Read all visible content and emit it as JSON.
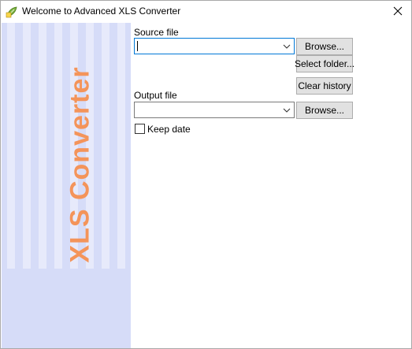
{
  "window": {
    "title": "Welcome to Advanced XLS Converter",
    "icon": "app-leaf-icon",
    "close": "close-icon"
  },
  "banner": {
    "text": "XLS Converter",
    "colors": {
      "background": "#d6dcf8",
      "stripe": "#e7eafb",
      "text": "#f4945a"
    }
  },
  "source": {
    "label": "Source file",
    "value": "",
    "browse_label": "Browse...",
    "select_folder_label": "Select folder...",
    "clear_history_label": "Clear history"
  },
  "output": {
    "label": "Output file",
    "value": "",
    "browse_label": "Browse..."
  },
  "keep_date": {
    "label": "Keep date",
    "checked": false
  }
}
